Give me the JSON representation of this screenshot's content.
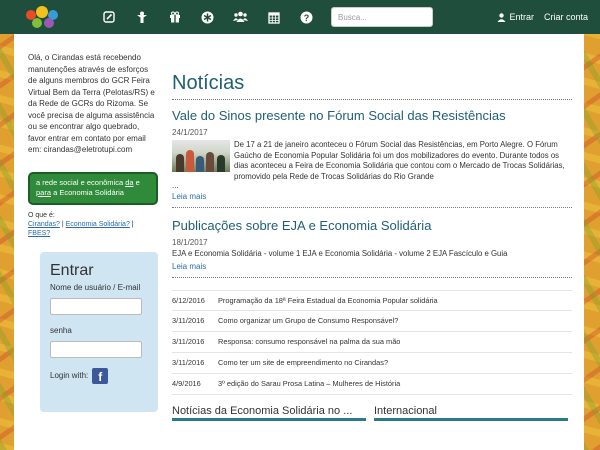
{
  "nav": {
    "search_placeholder": "Busca...",
    "login_label": "Entrar",
    "signup_label": "Criar conta",
    "icons": [
      "pencil-icon",
      "person-icon",
      "gift-icon",
      "asterisk-icon",
      "users-icon",
      "calendar-icon",
      "question-icon"
    ]
  },
  "sidebar": {
    "notice": "Olá, o Cirandas está recebendo manutenções através de esforços de alguns membros do GCR Feira Virtual Bem da Terra (Pelotas/RS) e da Rede de GCRs do Rizoma. Se você precisa de alguma assistência ou se encontrar algo quebrado, favor entrar em contato por email em: cirandas@eletrotupi.com",
    "tagline_a": "a rede social e econômica ",
    "tagline_da": "da",
    "tagline_e": " e ",
    "tagline_para": "para",
    "tagline_end": " a Economia Solidária",
    "oque_label": "O que é:",
    "oque_links": [
      "Cirandas?",
      "Economia Solidária?",
      "FBES?"
    ],
    "login": {
      "title": "Entrar",
      "user_label": "Nome de usuário / E-mail",
      "password_label": "senha",
      "login_with": "Login with:",
      "fb_letter": "f"
    }
  },
  "main": {
    "title": "Notícias",
    "articles": [
      {
        "title": "Vale do Sinos presente no Fórum Social das Resistências",
        "date": "24/1/2017",
        "text": "De 17 a 21 de janeiro aconteceu o Fórum Social das Resistências, em Porto Alegre. O Fórum Gaúcho de Economia Popular Solidária foi um dos mobilizadores do evento. Durante todos os dias aconteceu a Feira de Economia Solidária que contou com o Mercado de Trocas Solidárias, promovido pela Rede de Trocas Solidárias do Rio Grande",
        "ellipsis": "...",
        "more": "Leia mais"
      },
      {
        "title": "Publicações sobre EJA e Economia Solidária",
        "date": "18/1/2017",
        "text": "EJA e Economia Solidária - volume 1 EJA e Economia Solidária - volume 2 EJA Fascículo e Guia",
        "more": "Leia mais"
      }
    ],
    "news": [
      {
        "date": "6/12/2016",
        "title": "Programação da 18ª Feira Estadual da Economia Popular solidária"
      },
      {
        "date": "3/11/2016",
        "title": "Como organizar um Grupo de Consumo Responsável?"
      },
      {
        "date": "3/11/2016",
        "title": "Responsa: consumo responsável na palma da sua mão"
      },
      {
        "date": "3/11/2016",
        "title": "Como ter um site de empreendimento no Cirandas?"
      },
      {
        "date": "4/9/2016",
        "title": "3º edição do Sarau Prosa Latina – Mulheres de História"
      }
    ],
    "col1_title": "Notícias da Economia Solidária no ...",
    "col2_title": "Internacional"
  }
}
